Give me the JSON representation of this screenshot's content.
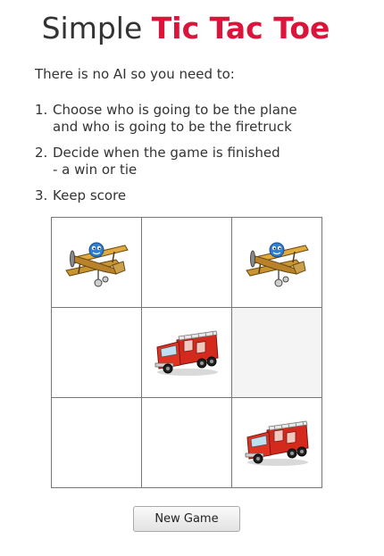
{
  "title": {
    "prefix": "Simple",
    "accent": "Tic Tac Toe"
  },
  "intro": "There is no AI so you need to:",
  "steps": [
    {
      "num": "1.",
      "lines": [
        "Choose who is going to be the plane",
        "and who is going to be the firetruck"
      ]
    },
    {
      "num": "2.",
      "lines": [
        "Decide when the game is finished",
        "- a win or tie"
      ]
    },
    {
      "num": "3.",
      "lines": [
        "Keep score"
      ]
    }
  ],
  "board": {
    "cells": [
      "plane",
      "",
      "plane",
      "",
      "firetruck",
      "",
      "",
      "",
      "firetruck"
    ],
    "highlighted_cell": 5
  },
  "new_game_label": "New Game",
  "colors": {
    "accent": "#dc143c",
    "text": "#333333",
    "grid": "#777777"
  },
  "icons": {
    "plane": "biplane-icon",
    "firetruck": "firetruck-icon"
  }
}
